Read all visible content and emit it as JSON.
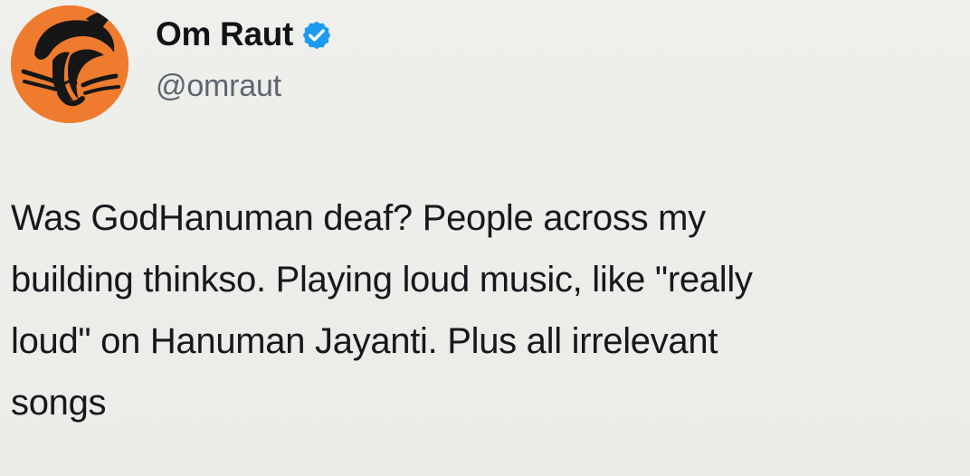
{
  "author": {
    "display_name": "Om Raut",
    "handle": "@omraut",
    "verified": true,
    "avatar_icon": "profile-avatar-orange",
    "accent_color": "#ef7b2e",
    "verified_color": "#1d9bf0"
  },
  "tweet": {
    "lines": [
      "Was GodHanuman deaf? People across my",
      "building thinkso. Playing loud music, like \"really",
      "loud\" on Hanuman Jayanti. Plus all irrelevant",
      "songs"
    ]
  }
}
